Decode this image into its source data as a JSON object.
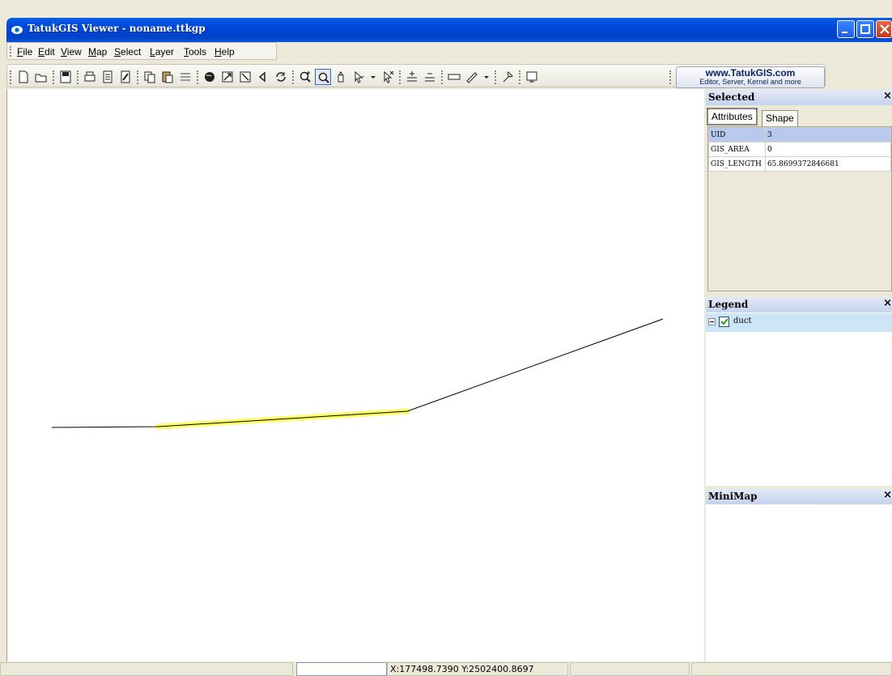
{
  "window": {
    "title": "TatukGIS Viewer - noname.ttkgp"
  },
  "menu": {
    "items": [
      {
        "u": "F",
        "rest": "ile"
      },
      {
        "u": "E",
        "rest": "dit"
      },
      {
        "u": "V",
        "rest": "iew"
      },
      {
        "u": "M",
        "rest": "ap"
      },
      {
        "u": "S",
        "rest": "elect"
      },
      {
        "u": "L",
        "rest": "ayer"
      },
      {
        "u": "T",
        "rest": "ools"
      },
      {
        "u": "H",
        "rest": "elp"
      }
    ]
  },
  "toolbar": {
    "buttons": [
      "new-icon",
      "open-icon",
      "save-icon",
      "print-icon",
      "print-preview-icon",
      "export-icon",
      "copy-icon",
      "paste-icon",
      "layers-icon",
      "globe-icon",
      "zoom-extent-icon",
      "zoom-layer-icon",
      "back-icon",
      "refresh-icon",
      "zoom-in-icon",
      "zoom-icon",
      "pan-icon",
      "select-icon",
      "deselect-icon",
      "add-line-icon",
      "remove-line-icon",
      "measure-icon",
      "ruler-icon",
      "info-icon",
      "properties-icon"
    ],
    "link_url": "www.TatukGIS.com",
    "link_tagline": "Editor, Server, Kernel and more"
  },
  "selected_panel": {
    "title": "Selected",
    "tabs": [
      "Attributes",
      "Shape"
    ],
    "rows": [
      {
        "key": "UID",
        "value": "3"
      },
      {
        "key": "GIS_AREA",
        "value": "0"
      },
      {
        "key": "GIS_LENGTH",
        "value": "65.8699372846681"
      }
    ]
  },
  "legend_panel": {
    "title": "Legend",
    "layer": {
      "name": "duct",
      "visible": true
    }
  },
  "minimap_panel": {
    "title": "MiniMap"
  },
  "status": {
    "coordinates": "X:177498.7390 Y:2502400.8697"
  },
  "colors": {
    "highlight": "#ffff66",
    "line": "#000000",
    "titlebar": "#0046d6"
  }
}
